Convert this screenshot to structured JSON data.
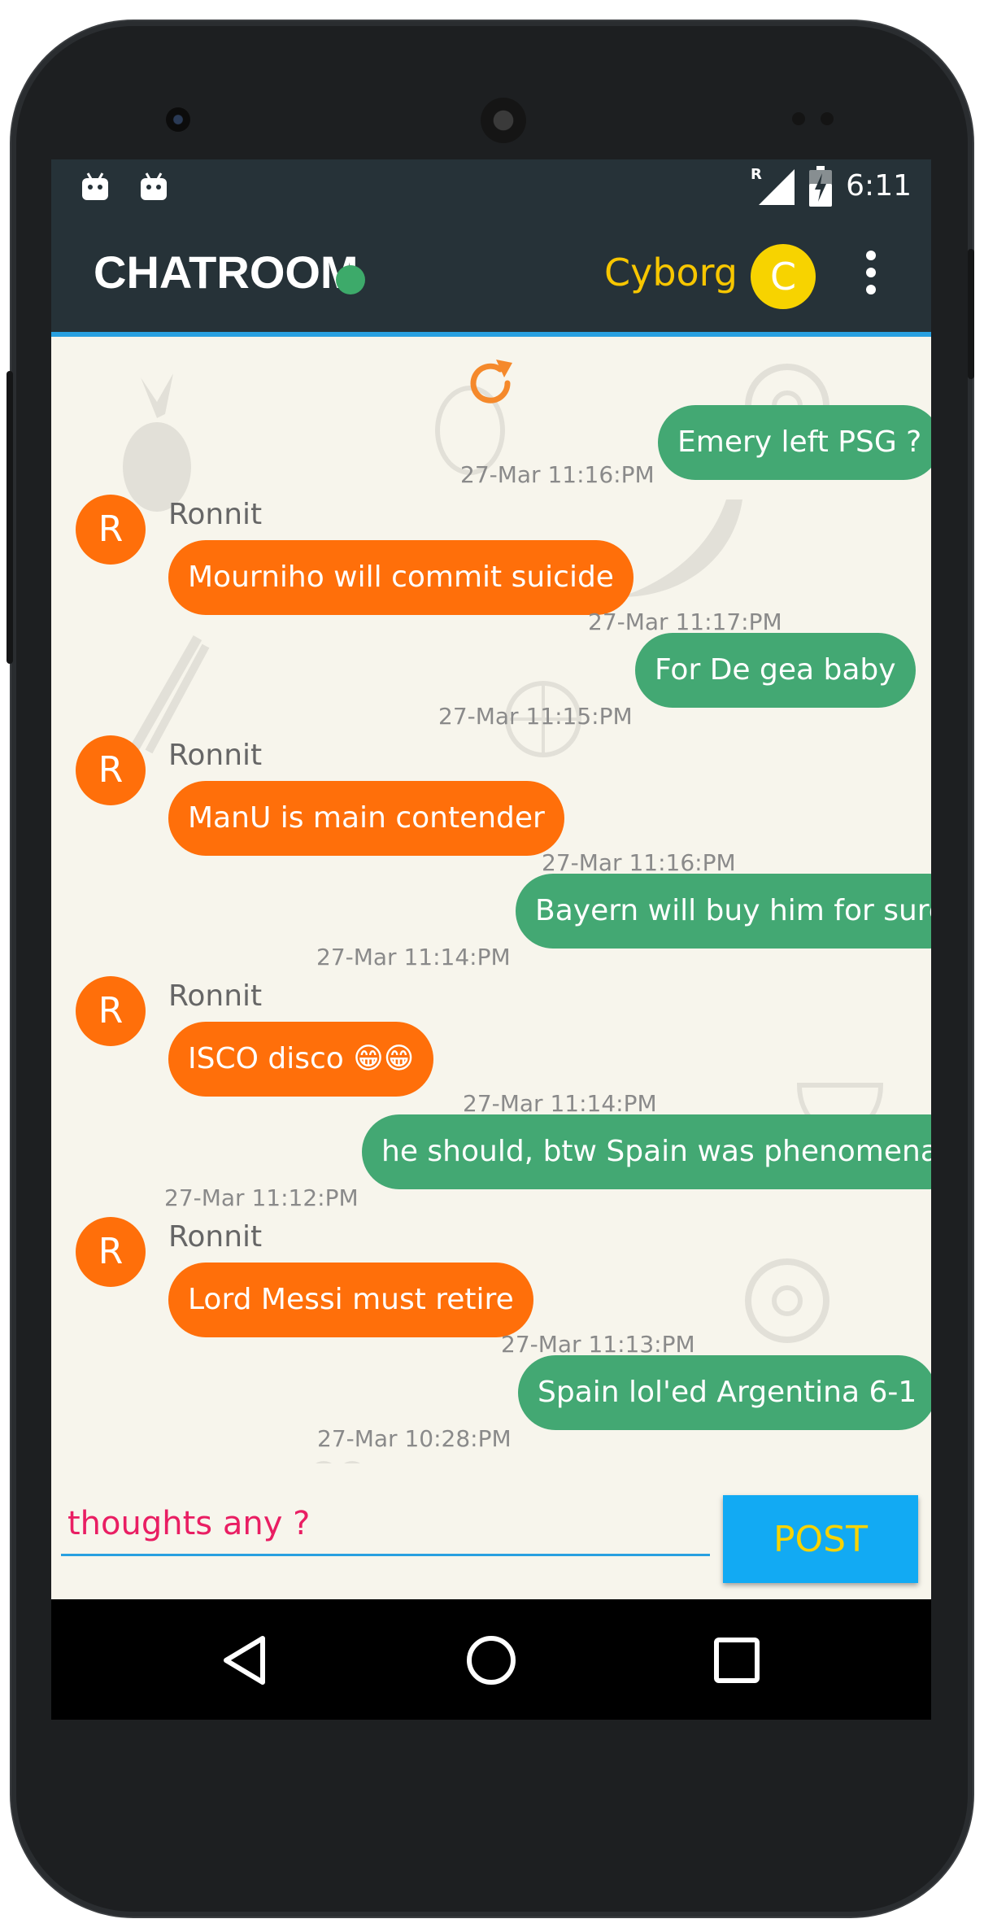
{
  "status_bar": {
    "time": "6:11",
    "left_icons": [
      "android-notification-icon",
      "android-notification-icon"
    ],
    "right_icons": [
      "roaming-indicator-icon",
      "signal-icon",
      "battery-charging-icon"
    ],
    "roaming_label": "R"
  },
  "toolbar": {
    "title": "CHATROOM",
    "online_color": "#3daa6a",
    "username": "Cyborg",
    "user_initial": "C",
    "menu_icon": "overflow-menu-icon"
  },
  "colors": {
    "toolbar_bg": "#263238",
    "incoming_bubble": "#ff6f0a",
    "outgoing_bubble": "#43a873",
    "accent": "#29a0e0",
    "post_button": "#12aaf3",
    "post_text": "#f7d300",
    "input_text": "#e91e63",
    "username": "#f7c600"
  },
  "chat": {
    "refresh_icon": "refresh-icon",
    "messages": [
      {
        "direction": "out",
        "text": "Emery left PSG ?",
        "time": "27-Mar 11:16:PM"
      },
      {
        "direction": "in",
        "sender": "Ronnit",
        "initial": "R",
        "text": "Mourniho will commit suicide",
        "time": "27-Mar 11:17:PM"
      },
      {
        "direction": "out",
        "text": "For De gea baby",
        "time": "27-Mar 11:15:PM"
      },
      {
        "direction": "in",
        "sender": "Ronnit",
        "initial": "R",
        "text": "ManU is main contender",
        "time": "27-Mar 11:16:PM"
      },
      {
        "direction": "out",
        "text": "Bayern will buy him for sure",
        "time": "27-Mar 11:14:PM"
      },
      {
        "direction": "in",
        "sender": "Ronnit",
        "initial": "R",
        "text": "ISCO disco 😁😁",
        "time": "27-Mar 11:14:PM"
      },
      {
        "direction": "out",
        "text": "he should, btw Spain was phenomenal",
        "time": "27-Mar 11:12:PM"
      },
      {
        "direction": "in",
        "sender": "Ronnit",
        "initial": "R",
        "text": "Lord Messi must retire",
        "time": "27-Mar 11:13:PM"
      },
      {
        "direction": "out",
        "text": "Spain lol'ed Argentina 6-1",
        "time": "27-Mar 10:28:PM"
      }
    ]
  },
  "composer": {
    "value": "thoughts any ?",
    "post_label": "POST"
  },
  "nav_bar": {
    "buttons": [
      "back-icon",
      "home-icon",
      "recents-icon"
    ]
  }
}
